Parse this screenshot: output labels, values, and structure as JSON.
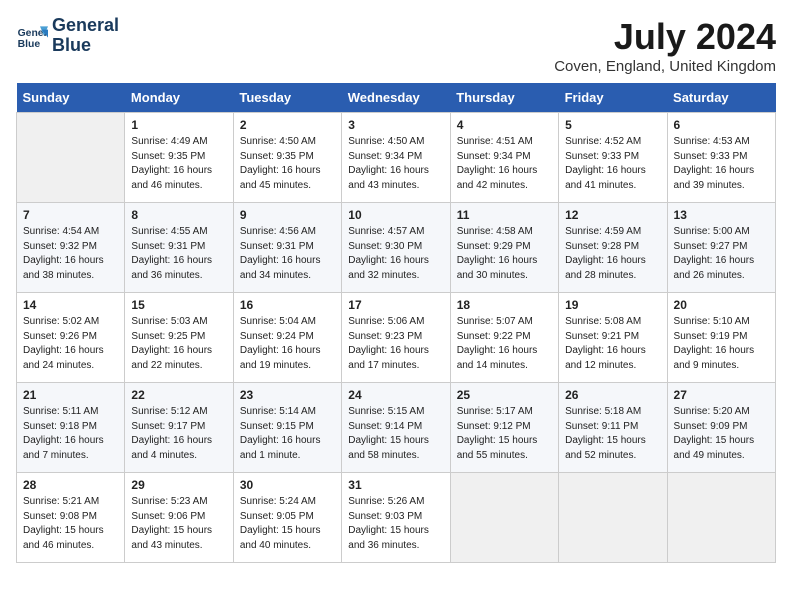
{
  "logo": {
    "line1": "General",
    "line2": "Blue"
  },
  "title": "July 2024",
  "location": "Coven, England, United Kingdom",
  "weekdays": [
    "Sunday",
    "Monday",
    "Tuesday",
    "Wednesday",
    "Thursday",
    "Friday",
    "Saturday"
  ],
  "weeks": [
    [
      {
        "day": "",
        "content": ""
      },
      {
        "day": "1",
        "content": "Sunrise: 4:49 AM\nSunset: 9:35 PM\nDaylight: 16 hours\nand 46 minutes."
      },
      {
        "day": "2",
        "content": "Sunrise: 4:50 AM\nSunset: 9:35 PM\nDaylight: 16 hours\nand 45 minutes."
      },
      {
        "day": "3",
        "content": "Sunrise: 4:50 AM\nSunset: 9:34 PM\nDaylight: 16 hours\nand 43 minutes."
      },
      {
        "day": "4",
        "content": "Sunrise: 4:51 AM\nSunset: 9:34 PM\nDaylight: 16 hours\nand 42 minutes."
      },
      {
        "day": "5",
        "content": "Sunrise: 4:52 AM\nSunset: 9:33 PM\nDaylight: 16 hours\nand 41 minutes."
      },
      {
        "day": "6",
        "content": "Sunrise: 4:53 AM\nSunset: 9:33 PM\nDaylight: 16 hours\nand 39 minutes."
      }
    ],
    [
      {
        "day": "7",
        "content": "Sunrise: 4:54 AM\nSunset: 9:32 PM\nDaylight: 16 hours\nand 38 minutes."
      },
      {
        "day": "8",
        "content": "Sunrise: 4:55 AM\nSunset: 9:31 PM\nDaylight: 16 hours\nand 36 minutes."
      },
      {
        "day": "9",
        "content": "Sunrise: 4:56 AM\nSunset: 9:31 PM\nDaylight: 16 hours\nand 34 minutes."
      },
      {
        "day": "10",
        "content": "Sunrise: 4:57 AM\nSunset: 9:30 PM\nDaylight: 16 hours\nand 32 minutes."
      },
      {
        "day": "11",
        "content": "Sunrise: 4:58 AM\nSunset: 9:29 PM\nDaylight: 16 hours\nand 30 minutes."
      },
      {
        "day": "12",
        "content": "Sunrise: 4:59 AM\nSunset: 9:28 PM\nDaylight: 16 hours\nand 28 minutes."
      },
      {
        "day": "13",
        "content": "Sunrise: 5:00 AM\nSunset: 9:27 PM\nDaylight: 16 hours\nand 26 minutes."
      }
    ],
    [
      {
        "day": "14",
        "content": "Sunrise: 5:02 AM\nSunset: 9:26 PM\nDaylight: 16 hours\nand 24 minutes."
      },
      {
        "day": "15",
        "content": "Sunrise: 5:03 AM\nSunset: 9:25 PM\nDaylight: 16 hours\nand 22 minutes."
      },
      {
        "day": "16",
        "content": "Sunrise: 5:04 AM\nSunset: 9:24 PM\nDaylight: 16 hours\nand 19 minutes."
      },
      {
        "day": "17",
        "content": "Sunrise: 5:06 AM\nSunset: 9:23 PM\nDaylight: 16 hours\nand 17 minutes."
      },
      {
        "day": "18",
        "content": "Sunrise: 5:07 AM\nSunset: 9:22 PM\nDaylight: 16 hours\nand 14 minutes."
      },
      {
        "day": "19",
        "content": "Sunrise: 5:08 AM\nSunset: 9:21 PM\nDaylight: 16 hours\nand 12 minutes."
      },
      {
        "day": "20",
        "content": "Sunrise: 5:10 AM\nSunset: 9:19 PM\nDaylight: 16 hours\nand 9 minutes."
      }
    ],
    [
      {
        "day": "21",
        "content": "Sunrise: 5:11 AM\nSunset: 9:18 PM\nDaylight: 16 hours\nand 7 minutes."
      },
      {
        "day": "22",
        "content": "Sunrise: 5:12 AM\nSunset: 9:17 PM\nDaylight: 16 hours\nand 4 minutes."
      },
      {
        "day": "23",
        "content": "Sunrise: 5:14 AM\nSunset: 9:15 PM\nDaylight: 16 hours\nand 1 minute."
      },
      {
        "day": "24",
        "content": "Sunrise: 5:15 AM\nSunset: 9:14 PM\nDaylight: 15 hours\nand 58 minutes."
      },
      {
        "day": "25",
        "content": "Sunrise: 5:17 AM\nSunset: 9:12 PM\nDaylight: 15 hours\nand 55 minutes."
      },
      {
        "day": "26",
        "content": "Sunrise: 5:18 AM\nSunset: 9:11 PM\nDaylight: 15 hours\nand 52 minutes."
      },
      {
        "day": "27",
        "content": "Sunrise: 5:20 AM\nSunset: 9:09 PM\nDaylight: 15 hours\nand 49 minutes."
      }
    ],
    [
      {
        "day": "28",
        "content": "Sunrise: 5:21 AM\nSunset: 9:08 PM\nDaylight: 15 hours\nand 46 minutes."
      },
      {
        "day": "29",
        "content": "Sunrise: 5:23 AM\nSunset: 9:06 PM\nDaylight: 15 hours\nand 43 minutes."
      },
      {
        "day": "30",
        "content": "Sunrise: 5:24 AM\nSunset: 9:05 PM\nDaylight: 15 hours\nand 40 minutes."
      },
      {
        "day": "31",
        "content": "Sunrise: 5:26 AM\nSunset: 9:03 PM\nDaylight: 15 hours\nand 36 minutes."
      },
      {
        "day": "",
        "content": ""
      },
      {
        "day": "",
        "content": ""
      },
      {
        "day": "",
        "content": ""
      }
    ]
  ]
}
